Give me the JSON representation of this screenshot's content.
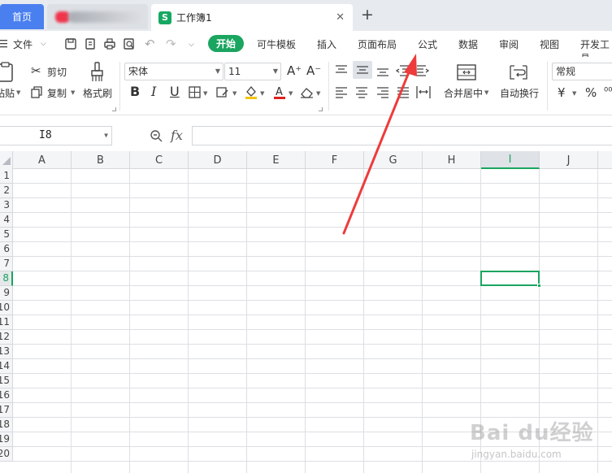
{
  "tabs": {
    "home_label": "首页",
    "active_title": "工作簿1",
    "sheet_logo": "S",
    "close_glyph": "✕",
    "plus_glyph": "+"
  },
  "menu": {
    "file_label": "文件",
    "start_label": "开始",
    "items": [
      "可牛模板",
      "插入",
      "页面布局",
      "公式",
      "数据",
      "审阅",
      "视图",
      "开发工具"
    ]
  },
  "ribbon": {
    "paste_label": "粘贴",
    "cut_label": "剪切",
    "copy_label": "复制",
    "format_painter_label": "格式刷",
    "font_name": "宋体",
    "font_size": "11",
    "bold": "B",
    "italic": "I",
    "underline": "U",
    "merge_label": "合并居中",
    "wrap_label": "自动换行",
    "number_format": "常规",
    "currency_glyph": "¥",
    "percent_glyph": "%"
  },
  "formula_bar": {
    "cell_ref": "I8",
    "fx_label": "fx",
    "value": ""
  },
  "grid": {
    "columns": [
      "A",
      "B",
      "C",
      "D",
      "E",
      "F",
      "G",
      "H",
      "I",
      "J"
    ],
    "active_column": "I",
    "rows": [
      "1",
      "2",
      "3",
      "4",
      "5",
      "6",
      "7",
      "8",
      "9",
      "10",
      "11",
      "12",
      "13",
      "14",
      "15",
      "16",
      "17",
      "18",
      "19",
      "20"
    ],
    "active_row": "8"
  },
  "colors": {
    "accent_green": "#1aa560",
    "home_tab_blue": "#4a7ff0",
    "annotation_red": "#ee3b3b"
  },
  "watermark": {
    "main": "Bai du经验",
    "sub": "jingyan.baidu.com"
  }
}
